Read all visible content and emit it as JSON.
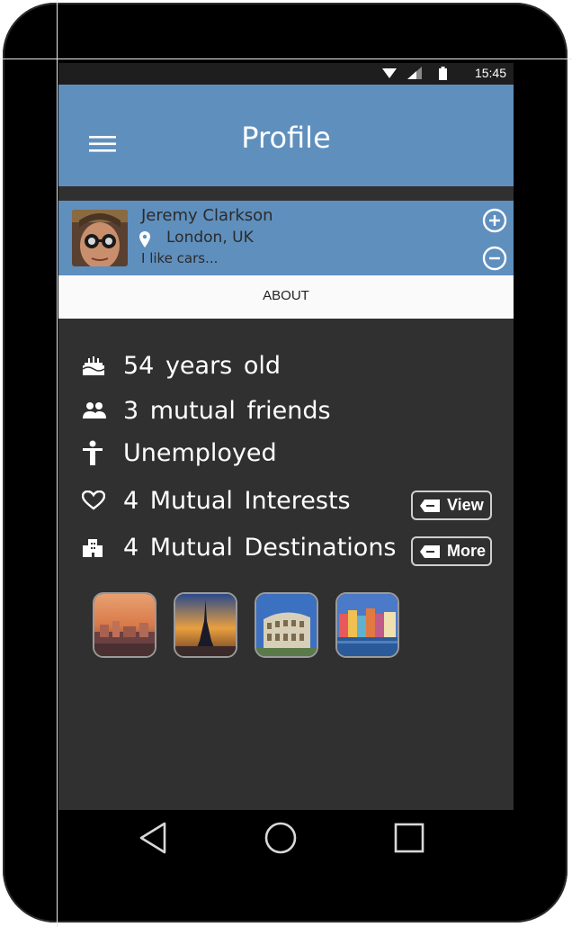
{
  "status_bar": {
    "time": "15:45",
    "icons": [
      "wifi-icon",
      "signal-icon",
      "battery-icon"
    ]
  },
  "app_bar": {
    "title": "Profile",
    "menu_icon": "hamburger-menu-icon"
  },
  "profile": {
    "name": "Jeremy Clarkson",
    "location": "London, UK",
    "bio": "I like cars..."
  },
  "tabs": {
    "about": "ABOUT"
  },
  "details": {
    "age": "54 years old",
    "mutual_friends": "3 mutual friends",
    "employment": "Unemployed",
    "interests": "4 Mutual Interests",
    "destinations": "4 Mutual Destinations"
  },
  "actions": {
    "view": "View",
    "more": "More"
  },
  "colors": {
    "accent": "#5f8fbd",
    "background": "#303030",
    "text": "#ffffff"
  },
  "destination_thumbnails": [
    "sunset-town",
    "eiffel-tower",
    "colosseum",
    "harbour-houses"
  ],
  "nav": [
    "back-icon",
    "home-icon",
    "recents-icon"
  ]
}
